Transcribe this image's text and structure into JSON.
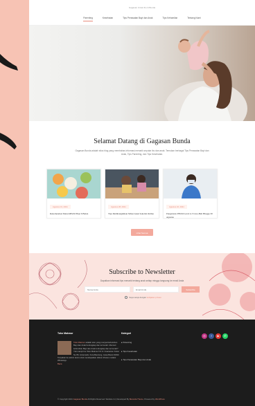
{
  "site": {
    "tagline": "Gagasan Untuk Ibu & Bunda"
  },
  "nav": [
    "Parenting",
    "Kesehatan",
    "Tips Perawatan Bayi dan Anak",
    "Tips Kehamilan",
    "Tentang Kami"
  ],
  "welcome": {
    "title": "Selamat Datang di Gagasan Bunda",
    "text": "Gagasan Bunda adalah situs blog yang membahas informasi menarik seputar ibu dan anak. Temukan berbagai Tips Perawatan Bayi dan Anak, Tips Parenting, dan Tips Kesehatan."
  },
  "posts": [
    {
      "date": "Agustus 31, 2021",
      "title": "Rekomendasi Menu MPASI Bayi 6 Bulan"
    },
    {
      "date": "Agustus 28, 2021",
      "title": "Tips Membangkitkan Minat Anak Sekolah Online"
    },
    {
      "date": "Agustus 22, 2021",
      "title": "Pengaturan PPKM Level 4-3 Jawa-Bali Hingga 30 Agustus"
    }
  ],
  "more_button": "Lihat Semua",
  "newsletter": {
    "title": "Subscribe to Newsletter",
    "text": "Dapatkan informasi tips menarik tentang anak setiap minggu langsung ke email Anda",
    "name_placeholder": "Nama Anda",
    "email_placeholder": "Email Anda",
    "button": "Subscribe",
    "agree": "Saya setuju dengan",
    "agree_link": "kebijakan privasi"
  },
  "footer": {
    "about_title": "Toko Makmur",
    "about_link": "Toko Makmur",
    "about_text": "adalah toko yang menjual kebutuhan Bayi dan Anak berlengkap dan termurah. Mencari kebutuhan Bayi dan Anak terlengkap dan termurah? Yuk mampir ke Toko Makmur! Di Jl. Cisaranten Kulon No.55, Arcamanik, Kota Bandung, Jawa Barat 40293. Tanyakan ke admin kami untuk mendapatkan diskon khusus melalui WhatsApp.",
    "about_more": "Baca",
    "cat_title": "Kategori",
    "categories": [
      "Parenting",
      "Tips Kesehatan",
      "Tips Perawatan Bayi dan Anak"
    ],
    "copyright": "© Copyright 2021",
    "brand": "Gagasan Bunda",
    "copyright_rest": "All Rights Reserved. Website Ini | Developed By",
    "developer": "Beranda Theme",
    "powered": ", Powered by",
    "wordpress": "WordPress"
  },
  "colors": {
    "accent": "#f3a99c",
    "background": "#f7c3b4",
    "footer": "#1c1c1c"
  }
}
